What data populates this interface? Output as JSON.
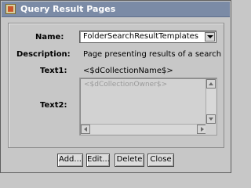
{
  "window": {
    "title": "Query Result Pages"
  },
  "form": {
    "name_label": "Name:",
    "name_value": "FolderSearchResultTemplates",
    "description_label": "Description:",
    "description_value": "Page presenting results of a search",
    "text1_label": "Text1:",
    "text1_value": "<$dCollectionName$>",
    "text2_label": "Text2:",
    "text2_value": "<$dCollectionOwner$>"
  },
  "buttons": {
    "add": "Add...",
    "edit": "Edit...",
    "delete": "Delete",
    "close": "Close"
  }
}
